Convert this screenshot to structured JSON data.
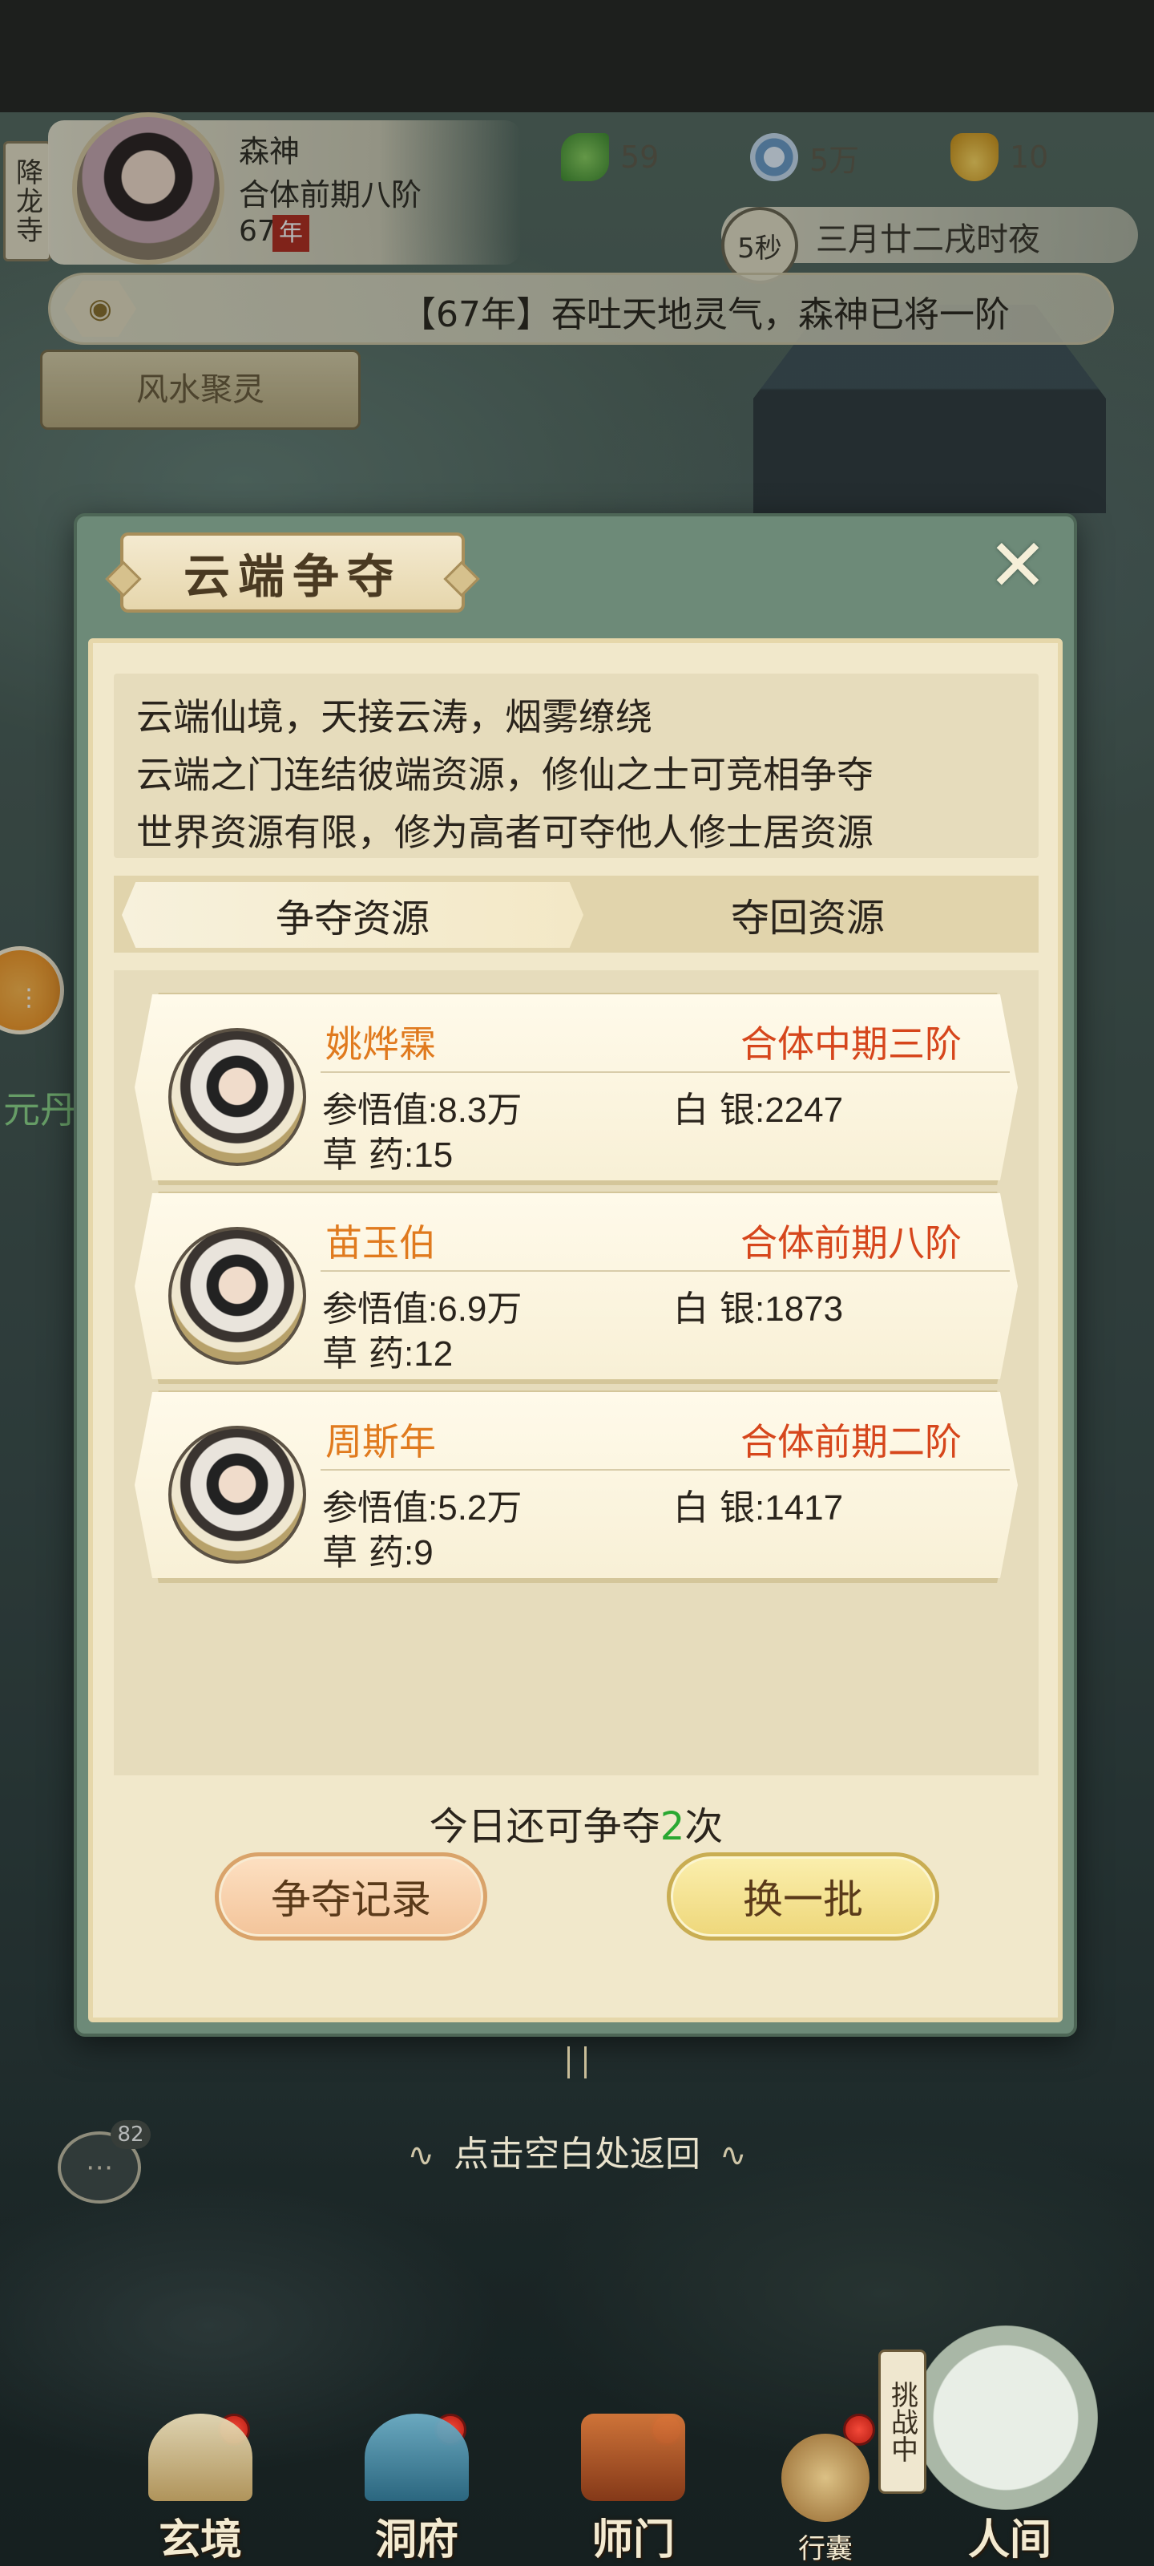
{
  "hud": {
    "temple_sign": "降龙寺",
    "player_name": "森神",
    "player_rank": "合体前期八阶",
    "player_age": "67",
    "age_badge": "年",
    "resources": [
      {
        "icon": "leaf-icon",
        "value": "59"
      },
      {
        "icon": "coin-icon",
        "value": "5万"
      },
      {
        "icon": "ingot-icon",
        "value": "10"
      }
    ],
    "timer": "5秒",
    "game_date": "三月廿二戌时夜",
    "ticker": "【67年】吞吐天地灵气，森神已将一阶",
    "fengshui_label": "风水聚灵"
  },
  "side": {
    "side_text": "元丹",
    "chat_count": "82"
  },
  "modal": {
    "title": "云端争夺",
    "close_icon": "close-icon",
    "description": [
      "云端仙境，天接云涛，烟雾缭绕",
      "云端之门连结彼端资源，修仙之士可竞相争夺",
      "世界资源有限，修为高者可夺他人修士居资源"
    ],
    "tabs": [
      {
        "label": "争夺资源",
        "active": true
      },
      {
        "label": "夺回资源",
        "active": false
      }
    ],
    "stat_labels": {
      "insight": "参悟值",
      "silver": "白  银",
      "herb": "草  药"
    },
    "opponents": [
      {
        "name": "姚烨霖",
        "rank": "合体中期三阶",
        "insight": ":8.3万",
        "silver": ":2247",
        "herb": ":15"
      },
      {
        "name": "苗玉伯",
        "rank": "合体前期八阶",
        "insight": ":6.9万",
        "silver": ":1873",
        "herb": ":12"
      },
      {
        "name": "周斯年",
        "rank": "合体前期二阶",
        "insight": ":5.2万",
        "silver": ":1417",
        "herb": ":9"
      }
    ],
    "remaining_prefix": "今日还可争夺",
    "remaining_count": "2",
    "remaining_suffix": "次",
    "record_button": "争夺记录",
    "refresh_button": "换一批"
  },
  "hint": "点击空白处返回",
  "bottom_nav": [
    {
      "label": "玄境",
      "badge": true
    },
    {
      "label": "洞府",
      "badge": true
    },
    {
      "label": "师门",
      "badge": true
    },
    {
      "label": "行囊",
      "badge": true
    },
    {
      "label": "人间",
      "badge": false
    }
  ],
  "challenge_tag": "挑战中",
  "colors": {
    "name_orange": "#e07a1e",
    "rank_red": "#d6461c",
    "count_green": "#2aa832",
    "modal_frame": "#6d8a78"
  }
}
